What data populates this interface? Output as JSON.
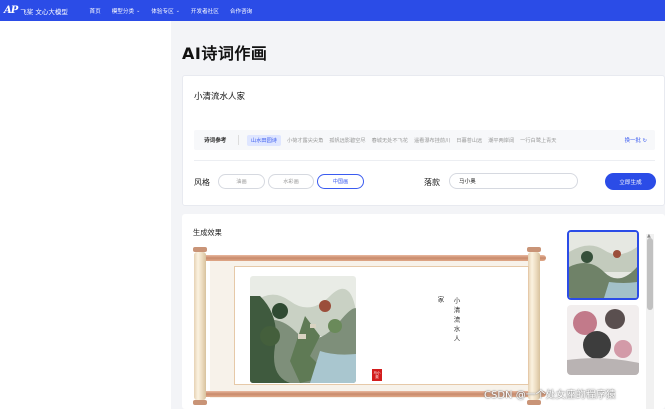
{
  "nav": {
    "logo": "AP",
    "brand": "飞桨 文心大模型",
    "items": [
      {
        "label": "首页",
        "has_menu": false
      },
      {
        "label": "模型分类",
        "has_menu": true
      },
      {
        "label": "体验专区",
        "has_menu": true
      },
      {
        "label": "开发者社区",
        "has_menu": false
      },
      {
        "label": "合作咨询",
        "has_menu": false
      }
    ]
  },
  "page": {
    "title": "AI诗词作画"
  },
  "prompt": {
    "value": "小清流水人家",
    "sample_label": "诗词参考",
    "samples": [
      "山水田园诗",
      "小荷才露尖尖角",
      "孤帆远影碧空尽",
      "春城无处不飞花",
      "遥看瀑布挂前川",
      "日暮苍山远",
      "潮平两岸阔",
      "一行白鹭上青天"
    ],
    "active_sample": 0,
    "swap_label": "换一批"
  },
  "style": {
    "label": "风格",
    "options": [
      "油画",
      "水彩画",
      "中国画"
    ],
    "selected": 2
  },
  "signature": {
    "label": "落款",
    "value": "马小奥"
  },
  "generate_label": "立即生成",
  "result": {
    "title": "生成效果",
    "poem_chars": "小清流水人",
    "author_char": "家",
    "seal_text": "马小奥"
  },
  "colors": {
    "brand": "#2b4ce7",
    "seal": "#d31d1d"
  },
  "watermark": "CSDN @一个处女座的程序猿"
}
